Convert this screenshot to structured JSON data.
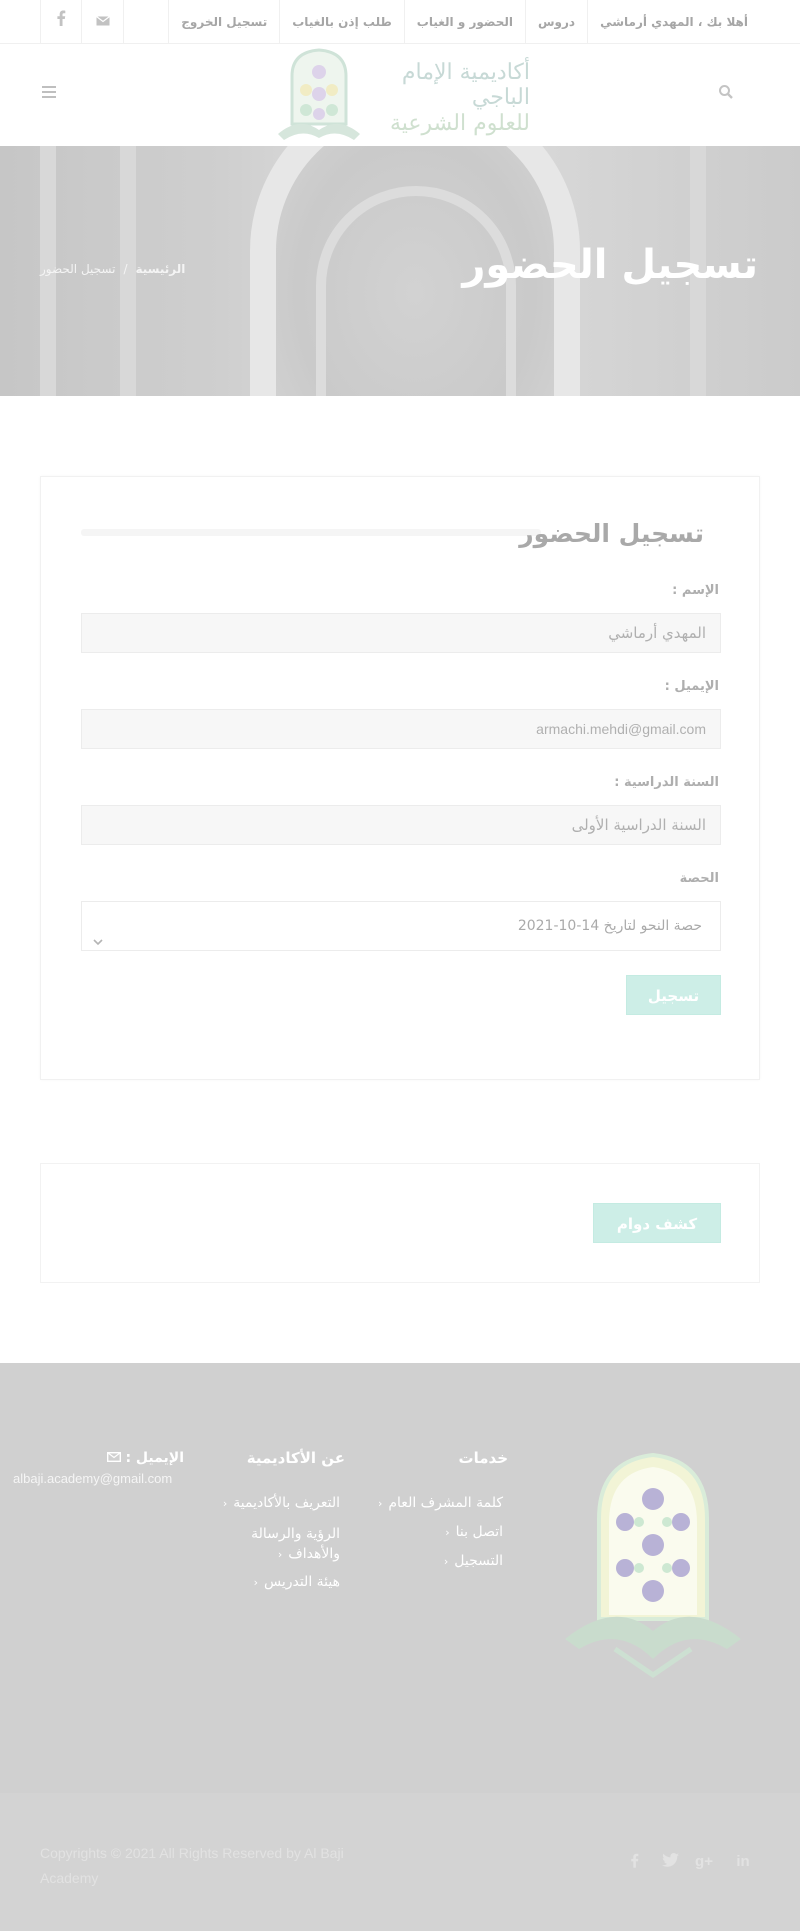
{
  "topbar": {
    "nav": [
      "أهلا بك ، المهدي أرماشي",
      "دروس",
      "الحضور و الغياب",
      "طلب إذن بالغياب",
      "تسجيل الخروج"
    ],
    "icons": [
      "facebook-icon",
      "envelope-icon"
    ]
  },
  "header": {
    "logo_line1": "أكاديمية الإمام الباجي",
    "logo_line2": "للعلوم الشرعية"
  },
  "hero": {
    "title": "تسجيل الحضور",
    "breadcrumb_home": "الرئيسية",
    "breadcrumb_sep": "/",
    "breadcrumb_current": "تسجيل الحضور"
  },
  "form": {
    "title": "تسجيل الحضور",
    "name_label": "الإسم :",
    "name_value": "المهدي أرماشي",
    "email_label": "الإيميل :",
    "email_value": "armachi.mehdi@gmail.com",
    "year_label": "السنة الدراسية :",
    "year_value": "السنة الدراسية الأولى",
    "session_label": "الحصة",
    "session_value": "حصة النحو لتاريخ 14-10-2021",
    "submit_label": "تسجيل"
  },
  "report": {
    "button_label": "كشف دوام"
  },
  "footer": {
    "services_title": "خدمات",
    "services": [
      "كلمة المشرف العام",
      "اتصل بنا",
      "التسجيل"
    ],
    "about_title": "عن الأكاديمية",
    "about": [
      "التعريف بالأكاديمية",
      "الرؤية والرسالة والأهداف",
      "هيئة التدريس"
    ],
    "email_label": "الإيميل :",
    "email": "albaji.academy@gmail.com",
    "arrow": "‹",
    "copyright": "Copyrights © 2021 All Rights Reserved by Al Baji Academy",
    "social": [
      "facebook-icon",
      "twitter-icon",
      "google-plus-icon",
      "linkedin-icon"
    ]
  },
  "colors": {
    "accent": "#cdeee7",
    "footer_bg": "#d0d0d0",
    "hero_title": "#ffffff"
  }
}
